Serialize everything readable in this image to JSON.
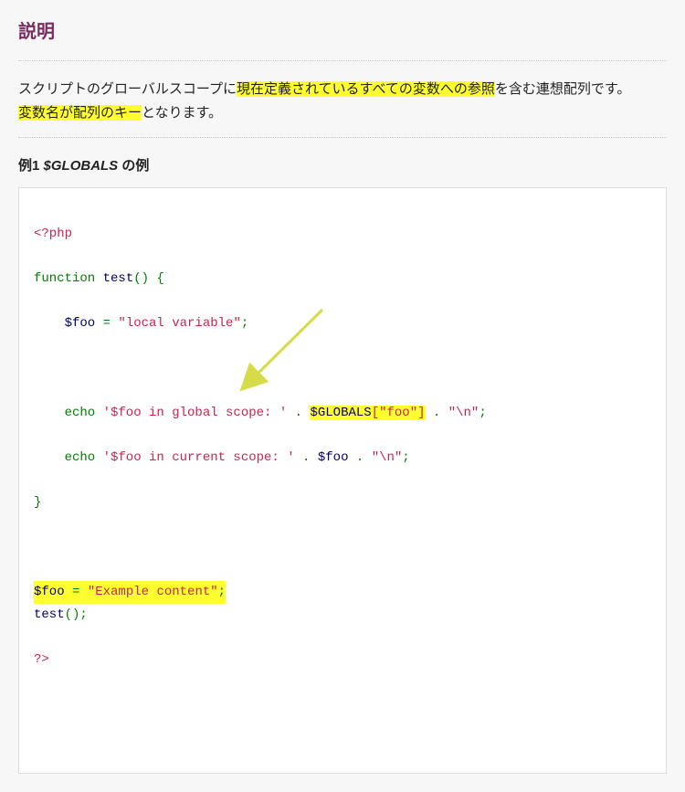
{
  "heading": "説明",
  "description": {
    "pre": "スクリプトのグローバルスコープに",
    "hl1": "現在定義されているすべての変数への参照",
    "mid": "を含む連想配列です。",
    "hl2": "変数名が配列のキー",
    "post": "となります。"
  },
  "example_label": {
    "prefix": "例1 ",
    "italic": "$GLOBALS",
    "suffix": " の例"
  },
  "code": {
    "l01_open": "<?php",
    "l02_kw": "function",
    "l02_name": " test",
    "l02_paren": "() {",
    "l03_var": "$foo",
    "l03_eq": " = ",
    "l03_str": "\"local variable\"",
    "l03_semi": ";",
    "l05_echo": "echo",
    "l05_str": " '$foo in global scope: '",
    "l05_dot1": " . ",
    "l05_globals": "$GLOBALS",
    "l05_idx": "[\"foo\"]",
    "l05_dot2": " . ",
    "l05_nl": "\"\\n\"",
    "l05_semi": ";",
    "l06_echo": "echo",
    "l06_str": " '$foo in current scope: '",
    "l06_dot1": " . ",
    "l06_var": "$foo",
    "l06_dot2": " . ",
    "l06_nl": "\"\\n\"",
    "l06_semi": ";",
    "l07_close": "}",
    "l09_var": "$foo",
    "l09_eq": " = ",
    "l09_str": "\"Example content\"",
    "l09_semi": ";",
    "l10_call": "test",
    "l10_paren": "();",
    "l11_close": "?>"
  }
}
